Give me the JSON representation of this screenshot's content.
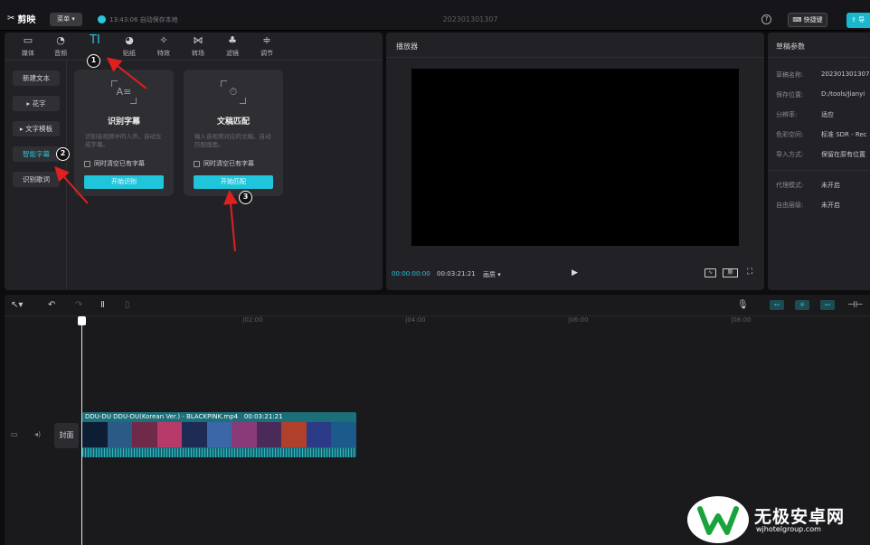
{
  "topbar": {
    "app_name": "剪映",
    "menu_label": "菜单",
    "save_status": "13:43:06 自动保存本地",
    "project_name": "202301301307",
    "shortcut_label": "快捷键",
    "export_label": "导"
  },
  "tabs": [
    {
      "label": "媒体",
      "icon": "media-icon"
    },
    {
      "label": "音频",
      "icon": "audio-icon"
    },
    {
      "label": "TI",
      "icon": "text-icon"
    },
    {
      "label": "贴纸",
      "icon": "sticker-icon"
    },
    {
      "label": "特效",
      "icon": "effects-icon"
    },
    {
      "label": "转场",
      "icon": "transition-icon"
    },
    {
      "label": "滤镜",
      "icon": "filter-icon"
    },
    {
      "label": "调节",
      "icon": "adjust-icon"
    }
  ],
  "sidebar": {
    "items": [
      {
        "label": "新建文本"
      },
      {
        "label": "花字"
      },
      {
        "label": "文字模板"
      },
      {
        "label": "智能字幕"
      },
      {
        "label": "识别歌词"
      }
    ]
  },
  "cards": [
    {
      "title": "识别字幕",
      "desc": "识别音视频中的人声，自动生成字幕。",
      "check": "同时清空已有字幕",
      "button": "开始识别"
    },
    {
      "title": "文稿匹配",
      "desc": "输入音视频对应的文稿，自动匹配画面。",
      "check": "同时清空已有字幕",
      "button": "开始匹配"
    }
  ],
  "player": {
    "title": "播放器",
    "current_time": "00:00:00:00",
    "total_time": "00:03:21:21",
    "ratio_label": "画质",
    "original_label": "原"
  },
  "params": {
    "title": "草稿参数",
    "rows": [
      {
        "k": "草稿名称:",
        "v": "202301301307"
      },
      {
        "k": "保存位置:",
        "v": "D:/tools/Jianyi"
      },
      {
        "k": "分辨率:",
        "v": "适应"
      },
      {
        "k": "色彩空间:",
        "v": "标准 SDR - Rec"
      },
      {
        "k": "导入方式:",
        "v": "保留在原有位置"
      },
      {
        "k": "代理模式:",
        "v": "未开启"
      },
      {
        "k": "自由层级:",
        "v": "未开启"
      }
    ]
  },
  "timeline": {
    "ruler": [
      "|02:00",
      "|04:00",
      "|06:00",
      "|08:00"
    ],
    "cover_label": "封面",
    "clip_label": "DDU-DU DDU-DU(Korean Ver.) - BLACKPINK.mp4",
    "clip_duration": "00:03:21:21"
  },
  "badges": [
    "1",
    "2",
    "3"
  ],
  "watermark": {
    "main": "无极安卓网",
    "sub": "wjhotelgroup.com"
  },
  "colors": {
    "accent": "#1fc5db",
    "annotation_arrow": "#e02020"
  }
}
